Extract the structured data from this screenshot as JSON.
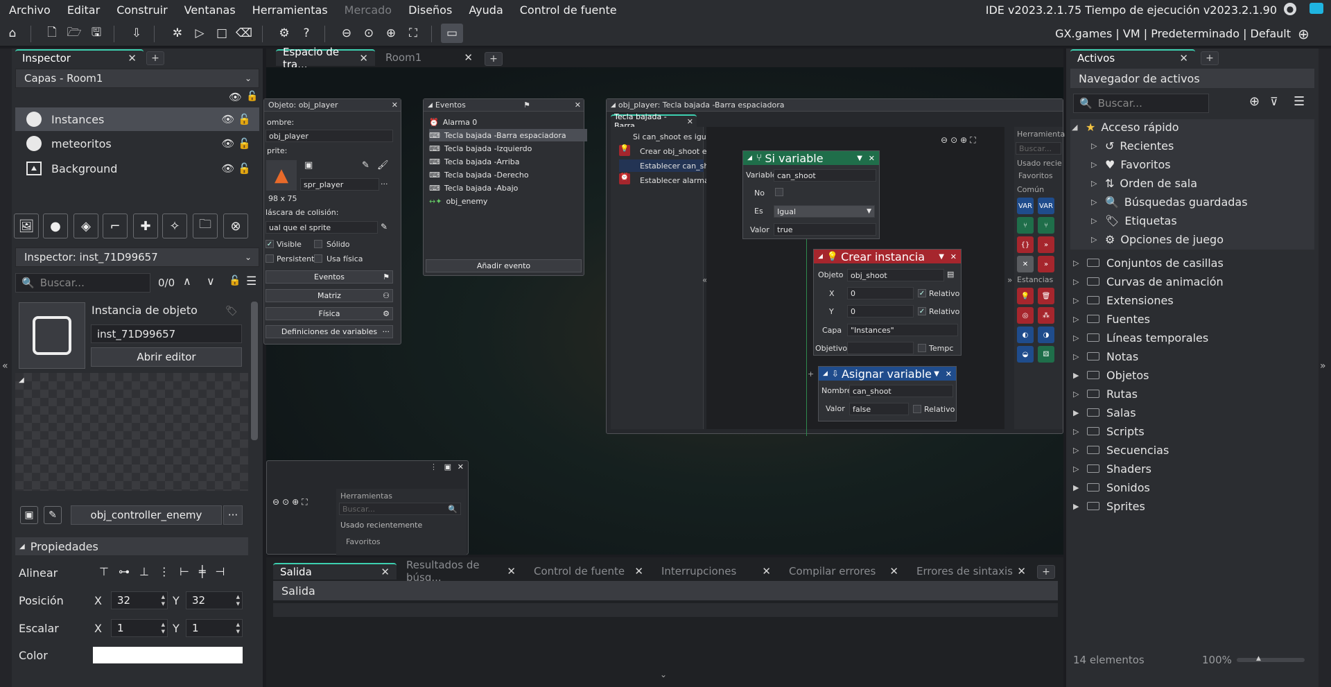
{
  "menu": {
    "items": [
      "Archivo",
      "Editar",
      "Construir",
      "Ventanas",
      "Herramientas",
      "Mercado",
      "Diseños",
      "Ayuda",
      "Control de fuente"
    ],
    "version": "IDE v2023.2.1.75  Tiempo de ejecución v2023.2.1.90"
  },
  "toolbar": {
    "targets": "GX.games | VM | Predeterminado | Default"
  },
  "inspector": {
    "tab": "Inspector",
    "layers_dropdown": "Capas - Room1",
    "layers": [
      "Instances",
      "meteoritos",
      "Background"
    ],
    "inst_dropdown": "Inspector: inst_71D99657",
    "search_placeholder": "Buscar...",
    "count": "0/0",
    "obj_type": "Instancia de objeto",
    "inst_name": "inst_71D99657",
    "open_editor": "Abrir editor",
    "object_field": "obj_controller_enemy",
    "props_header": "Propiedades",
    "align_label": "Alinear",
    "pos_label": "Posición",
    "scale_label": "Escalar",
    "color_label": "Color",
    "x": "X",
    "y": "Y",
    "pos_x": "32",
    "pos_y": "32",
    "scale_x": "1",
    "scale_y": "1"
  },
  "workspace": {
    "tabs": [
      "Espacio de tra...",
      "Room1"
    ]
  },
  "objwin": {
    "title": "Objeto: obj_player",
    "name_label": "ombre:",
    "name_value": "obj_player",
    "sprite_label": "prite:",
    "sprite_value": "spr_player",
    "size": "98 x 75",
    "mask_label": "láscara de colisión:",
    "mask_value": "ual que el sprite",
    "visible": "Visible",
    "solid": "Sólido",
    "persistent": "Persistente",
    "physics_use": "Usa física",
    "events_btn": "Eventos",
    "parent_btn": "Matriz",
    "physics_btn": "Física",
    "vardefs_btn": "Definiciones de variables"
  },
  "eventswin": {
    "title": "Eventos",
    "items": [
      "Alarma 0",
      "Tecla bajada -Barra espaciadora",
      "Tecla bajada -Izquierdo",
      "Tecla bajada -Arriba",
      "Tecla bajada -Derecho",
      "Tecla bajada -Abajo",
      "obj_enemy"
    ],
    "add": "Añadir evento"
  },
  "dnd": {
    "title": "obj_player: Tecla bajada -Barra espaciadora",
    "tab": "Tecla bajada -Barra ...",
    "list": [
      "Si can_shoot es igua",
      "Crear obj_shoot e",
      "Establecer can_sh",
      "Establecer alarma"
    ],
    "ifvar": {
      "title": "Si variable",
      "variable_label": "Variable",
      "variable": "can_shoot",
      "not_label": "No",
      "is_label": "Es",
      "is": "Igual",
      "value_label": "Valor",
      "value": "true"
    },
    "create": {
      "title": "Crear instancia",
      "obj_label": "Objeto",
      "obj": "obj_shoot",
      "x_label": "X",
      "x": "0",
      "y_label": "Y",
      "y": "0",
      "rel": "Relativo",
      "layer_label": "Capa",
      "layer": "\"Instances\"",
      "target_label": "Objetivo",
      "temp": "Tempc"
    },
    "assign": {
      "title": "Asignar variable",
      "name_label": "Nombre",
      "name": "can_shoot",
      "value_label": "Valor",
      "value": "false",
      "rel": "Relativo"
    },
    "tools": {
      "title": "Herramienta",
      "search": "Buscar...",
      "recent": "Usado recie",
      "favs": "Favoritos",
      "common": "Común",
      "instances": "Estancias"
    }
  },
  "lowerwin": {
    "title": "Herramientas",
    "search": "Buscar...",
    "recent": "Usado recientemente",
    "favs": "Favoritos"
  },
  "output": {
    "tabs": [
      "Salida",
      "Resultados de búsq...",
      "Control de fuente",
      "Interrupciones",
      "Compilar errores",
      "Errores de sintaxis"
    ],
    "header": "Salida"
  },
  "assets": {
    "tab": "Activos",
    "title": "Navegador de activos",
    "search": "Buscar...",
    "quick": "Acceso rápido",
    "quick_items": [
      "Recientes",
      "Favoritos",
      "Orden de sala",
      "Búsquedas guardadas",
      "Etiquetas",
      "Opciones de juego"
    ],
    "groups": [
      "Conjuntos de casillas",
      "Curvas de animación",
      "Extensiones",
      "Fuentes",
      "Líneas temporales",
      "Notas",
      "Objetos",
      "Rutas",
      "Salas",
      "Scripts",
      "Secuencias",
      "Shaders",
      "Sonidos",
      "Sprites"
    ],
    "count": "14 elementos",
    "zoom": "100%"
  },
  "colors": {
    "accent": "#3dd0b0",
    "ifvar": "#1f6e4a",
    "create": "#a6262d",
    "assign": "#1f4c8c"
  }
}
